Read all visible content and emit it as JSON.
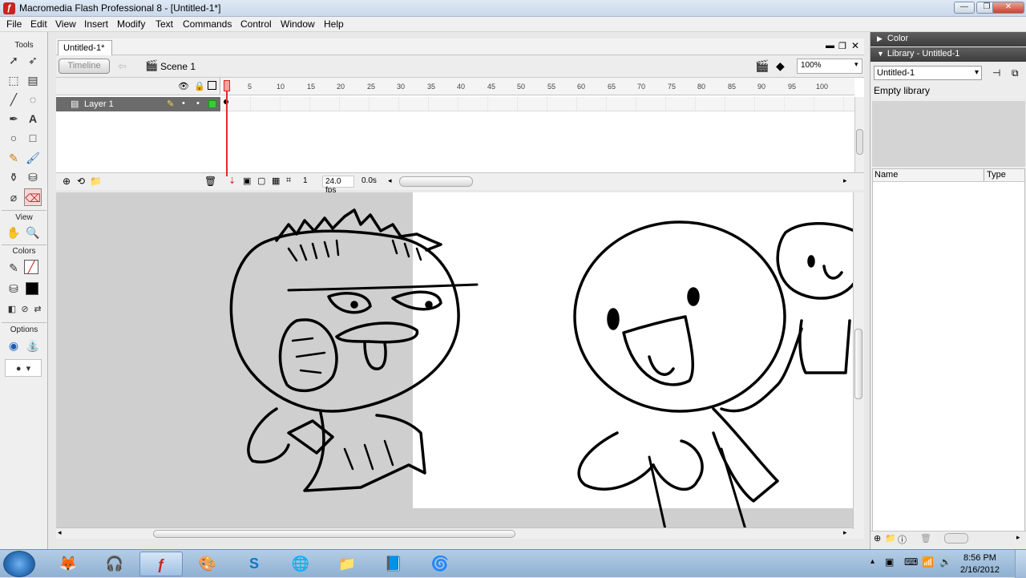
{
  "window": {
    "title": "Macromedia Flash Professional 8 - [Untitled-1*]"
  },
  "menu": [
    "File",
    "Edit",
    "View",
    "Insert",
    "Modify",
    "Text",
    "Commands",
    "Control",
    "Window",
    "Help"
  ],
  "tools_panel": {
    "tools_label": "Tools",
    "view_label": "View",
    "colors_label": "Colors",
    "options_label": "Options"
  },
  "document": {
    "tab_label": "Untitled-1*",
    "timeline_button": "Timeline",
    "scene_label": "Scene 1",
    "zoom": "100%"
  },
  "timeline": {
    "layer_name": "Layer 1",
    "frame_ticks": [
      "5",
      "10",
      "15",
      "20",
      "25",
      "30",
      "35",
      "40",
      "45",
      "50",
      "55",
      "60",
      "65",
      "70",
      "75",
      "80",
      "85",
      "90",
      "95",
      "100"
    ],
    "current_frame": "1",
    "frame_rate": "24.0 fps",
    "elapsed": "0.0s"
  },
  "panels": {
    "color_title": "Color",
    "library_title": "Library - Untitled-1",
    "library_select": "Untitled-1",
    "library_empty": "Empty library",
    "col_name": "Name",
    "col_type": "Type"
  },
  "taskbar": {
    "time": "8:56 PM",
    "date": "2/16/2012"
  }
}
